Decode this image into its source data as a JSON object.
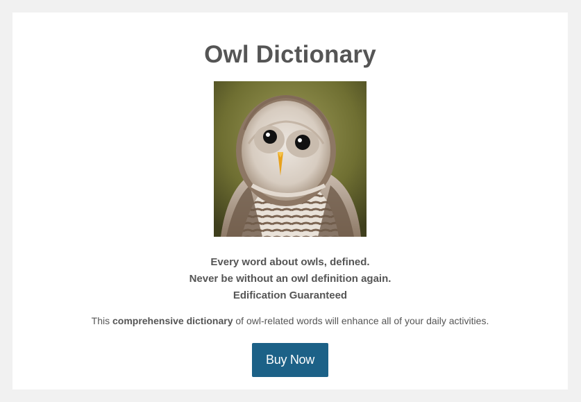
{
  "page": {
    "title": "Owl Dictionary"
  },
  "hero_image": {
    "alt": "Barred owl portrait",
    "subject": "owl-photo"
  },
  "taglines": [
    "Every word about owls, defined.",
    "Never be without an owl definition again.",
    "Edification Guaranteed"
  ],
  "description": {
    "prefix": "This ",
    "emphasis": "comprehensive dictionary",
    "suffix": " of owl-related words will enhance all of your daily activities."
  },
  "cta": {
    "label": "Buy Now"
  },
  "colors": {
    "background": "#f1f1f1",
    "card": "#ffffff",
    "text": "#555555",
    "button": "#1c6187",
    "button_text": "#ffffff"
  }
}
